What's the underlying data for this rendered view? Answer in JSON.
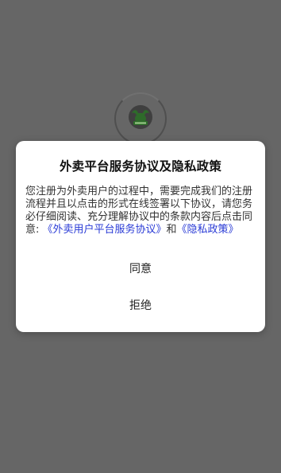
{
  "splash": {
    "logo_icon": "green-horned-animal-logo-icon",
    "spinner_icon": "loading-ring-icon"
  },
  "dialog": {
    "title": "外卖平台服务协议及隐私政策",
    "body_text": "您注册为外卖用户的过程中，需要完成我们的注册流程并且以点击的形式在线签署以下协议，请您务必仔细阅读、充分理解协议中的条款内容后点击同意: ",
    "service_agreement_link": "《外卖用户平台服务协议》",
    "conjunction": "和",
    "privacy_policy_link": "《隐私政策》",
    "agree_label": "同意",
    "refuse_label": "拒绝"
  },
  "colors": {
    "background": "#666666",
    "dialog": "#ffffff",
    "link": "#2a3bd6",
    "logo_green": "#2e6b2a"
  }
}
